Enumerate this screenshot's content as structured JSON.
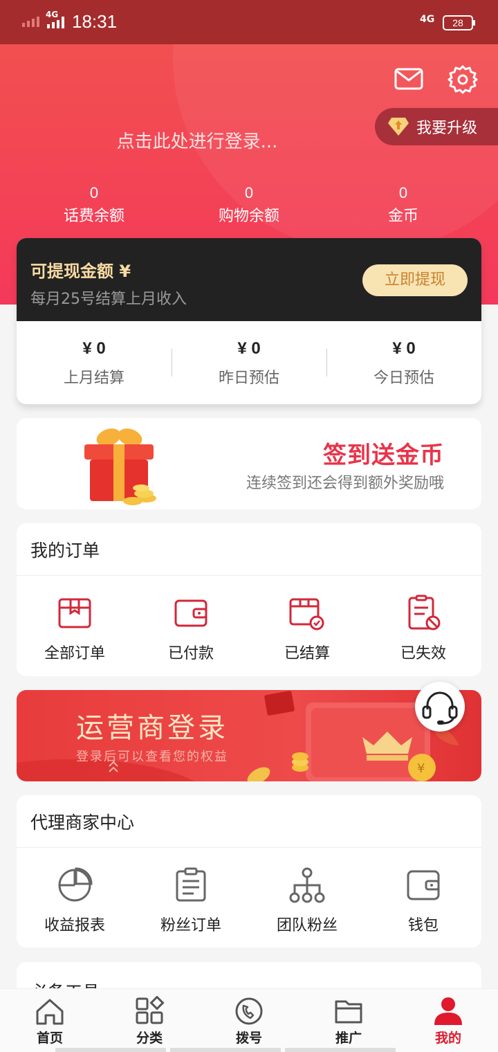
{
  "status_bar": {
    "network": "4G",
    "time": "18:31",
    "network2": "4G",
    "battery": "28"
  },
  "header": {
    "upgrade_label": "我要升级",
    "login_prompt": "点击此处进行登录...",
    "balances": [
      {
        "value": "0",
        "label": "话费余额"
      },
      {
        "value": "0",
        "label": "购物余额"
      },
      {
        "value": "0",
        "label": "金币"
      }
    ]
  },
  "withdraw": {
    "title": "可提现金额 ¥",
    "subtitle": "每月25号结算上月收入",
    "button": "立即提现",
    "stats": [
      {
        "amount": "¥ 0",
        "label": "上月结算"
      },
      {
        "amount": "¥ 0",
        "label": "昨日预估"
      },
      {
        "amount": "¥ 0",
        "label": "今日预估"
      }
    ]
  },
  "checkin": {
    "title": "签到送金币",
    "subtitle": "连续签到还会得到额外奖励哦"
  },
  "orders": {
    "title": "我的订单",
    "items": [
      {
        "label": "全部订单",
        "icon": "box-icon"
      },
      {
        "label": "已付款",
        "icon": "wallet-icon"
      },
      {
        "label": "已结算",
        "icon": "settled-box-icon"
      },
      {
        "label": "已失效",
        "icon": "invalid-document-icon"
      }
    ]
  },
  "operator_banner": {
    "title": "运营商登录",
    "subtitle": "登录后可以查看您的权益"
  },
  "agent_center": {
    "title": "代理商家中心",
    "items": [
      {
        "label": "收益报表",
        "icon": "pie-chart-icon"
      },
      {
        "label": "粉丝订单",
        "icon": "clipboard-icon"
      },
      {
        "label": "团队粉丝",
        "icon": "team-tree-icon"
      },
      {
        "label": "钱包",
        "icon": "wallet-icon"
      }
    ]
  },
  "tools": {
    "title": "必备工具"
  },
  "tabbar": {
    "tabs": [
      {
        "label": "首页",
        "icon": "home-icon"
      },
      {
        "label": "分类",
        "icon": "category-icon"
      },
      {
        "label": "拨号",
        "icon": "phone-icon"
      },
      {
        "label": "推广",
        "icon": "folder-icon"
      },
      {
        "label": "我的",
        "icon": "user-icon",
        "active": true
      }
    ]
  },
  "colors": {
    "brand_red": "#e0192d",
    "header_red": "#f25050",
    "gold": "#f7dba3"
  }
}
